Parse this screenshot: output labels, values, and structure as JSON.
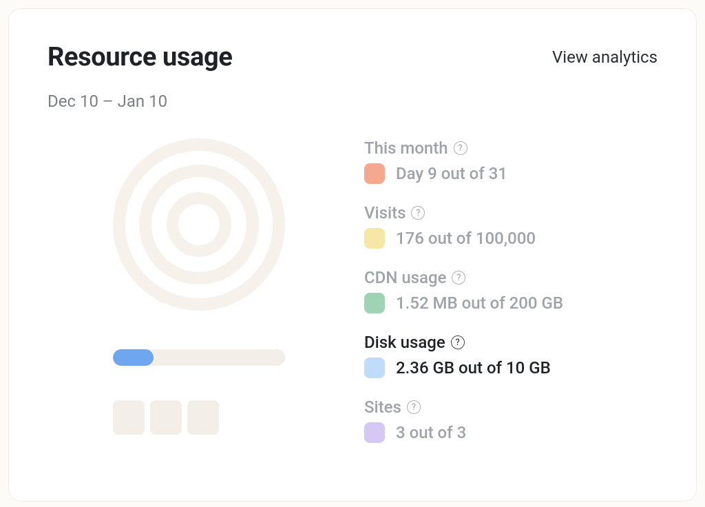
{
  "title": "Resource usage",
  "analytics_link": "View analytics",
  "date_range": "Dec 10 – Jan 10",
  "disk_bar_pct": 23.6,
  "sites_blocks": 3,
  "metrics": [
    {
      "key": "month",
      "label": "This month",
      "value": "Day 9 out of 31",
      "color": "#f5a88e",
      "active": false
    },
    {
      "key": "visits",
      "label": "Visits",
      "value": "176 out of 100,000",
      "color": "#f6e7a6",
      "active": false
    },
    {
      "key": "cdn",
      "label": "CDN usage",
      "value": "1.52 MB out of 200 GB",
      "color": "#9fd3b5",
      "active": false
    },
    {
      "key": "disk",
      "label": "Disk usage",
      "value": "2.36 GB out of 10 GB",
      "color": "#bfdcfb",
      "active": true
    },
    {
      "key": "sites",
      "label": "Sites",
      "value": "3 out of 3",
      "color": "#d5c8f5",
      "active": false
    }
  ]
}
